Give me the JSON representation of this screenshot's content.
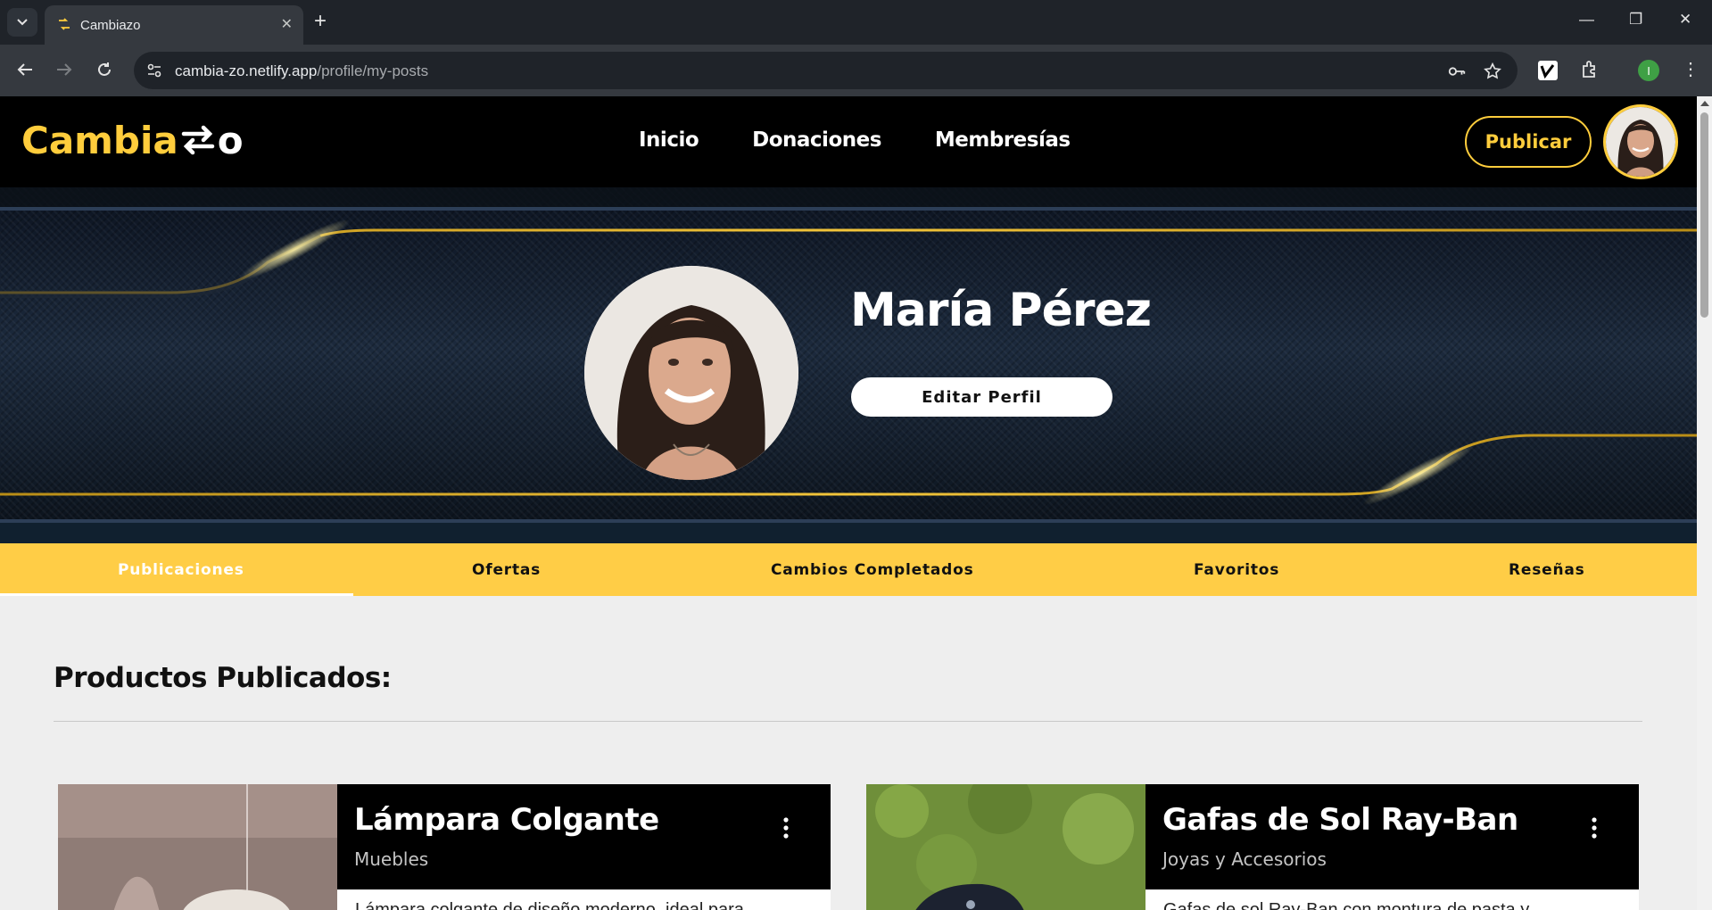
{
  "browser": {
    "tab_title": "Cambiazo",
    "url_domain": "cambia-zo.netlify.app",
    "url_path": "/profile/my-posts",
    "profile_initial": "I"
  },
  "header": {
    "logo_part1": "Cambia",
    "logo_part2": "zo",
    "nav": [
      "Inicio",
      "Donaciones",
      "Membresías"
    ],
    "publish_label": "Publicar"
  },
  "profile": {
    "name": "María Pérez",
    "edit_label": "Editar Perfil"
  },
  "tabs": [
    {
      "label": "Publicaciones",
      "active": true
    },
    {
      "label": "Ofertas",
      "active": false
    },
    {
      "label": "Cambios Completados",
      "active": false
    },
    {
      "label": "Favoritos",
      "active": false
    },
    {
      "label": "Reseñas",
      "active": false
    }
  ],
  "section_title": "Productos Publicados:",
  "posts": [
    {
      "title": "Lámpara Colgante",
      "category": "Muebles",
      "description": "Lámpara colgante de diseño moderno, ideal para"
    },
    {
      "title": "Gafas de Sol Ray-Ban",
      "category": "Joyas y Accesorios",
      "description": "Gafas de sol Ray-Ban con montura de pasta y"
    }
  ],
  "colors": {
    "accent": "#ffcd3c",
    "tabs_bg": "#ffcd46",
    "header_bg": "#000000"
  }
}
